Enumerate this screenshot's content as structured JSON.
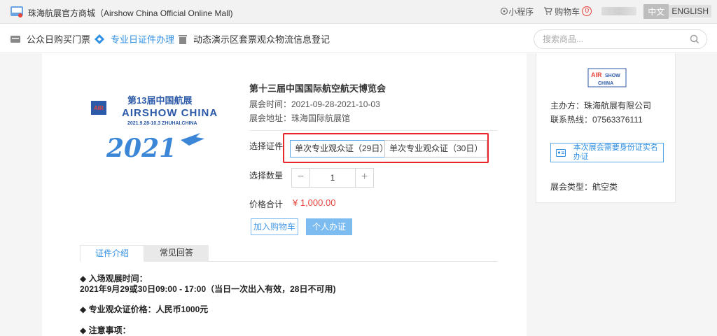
{
  "topbar": {
    "site_title": "珠海航展官方商城（Airshow China Official Online Mall)",
    "miniapp": "小程序",
    "cart": "购物车",
    "cart_count": "0",
    "lang_cn": "中文",
    "lang_en": "ENGLISH"
  },
  "nav": {
    "items": [
      {
        "label": "公众日购买门票",
        "icon": "ticket-icon"
      },
      {
        "label": "专业日证件办理",
        "icon": "diamond-icon",
        "active": true
      },
      {
        "label": "动态演示区套票观众物流信息登记",
        "icon": "trash-icon"
      }
    ],
    "search_placeholder": "搜索商品..."
  },
  "product": {
    "poster": {
      "line1": "第13届中国航展",
      "line2": "AIRSHOW CHINA",
      "line3": "2021.9.28-10.3 ZHUHAI.CHINA",
      "year": "2021",
      "badge": "AIR"
    },
    "title": "第十三届中国国际航空航天博览会",
    "time": "展会时间：2021-09-28-2021-10-03",
    "address": "展会地址：珠海国际航展馆",
    "choose_label": "选择证件",
    "options": [
      "单次专业观众证（29日）",
      "单次专业观众证（30日）"
    ],
    "qty_label": "选择数量",
    "qty_minus": "−",
    "qty_plus": "+",
    "qty_value": "1",
    "price_label": "价格合计",
    "price": "¥ 1,000.00",
    "add_cart": "加入购物车",
    "apply": "个人办证"
  },
  "tabs": [
    "证件介绍",
    "常见回答"
  ],
  "details": {
    "entry_title": "◆ 入场观展时间：",
    "entry_time": "2021年9月29或30日09:00 - 17:00（当日一次出入有效，28日不可用)",
    "price_line": "◆ 专业观众证价格：人民币1000元",
    "notes": "◆ 注意事项："
  },
  "side": {
    "organizer": "主办方：珠海航展有限公司",
    "hotline": "联系热线：07563376111",
    "notice": "本次展会需要身份证实名办证",
    "category": "展会类型：航空类",
    "logo_text1": "AIR",
    "logo_text2": "SHOW",
    "logo_text3": "CHINA"
  },
  "colors": {
    "accent": "#2f8fe3",
    "price": "#e8443b",
    "highlight_box": "#e8262b"
  }
}
